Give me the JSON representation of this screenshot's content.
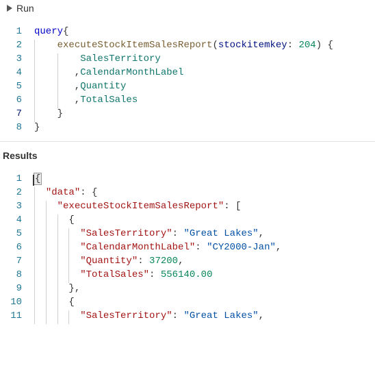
{
  "toolbar": {
    "run_label": "Run"
  },
  "results_header": "Results",
  "query_lines": [
    {
      "n": 1,
      "segs": [
        {
          "t": "query",
          "c": "kw"
        },
        {
          "t": "{",
          "c": "punc"
        }
      ]
    },
    {
      "n": 2,
      "indent": 1,
      "segs": [
        {
          "t": "    ",
          "c": ""
        },
        {
          "t": "executeStockItemSalesReport",
          "c": "call"
        },
        {
          "t": "(",
          "c": "punc"
        },
        {
          "t": "stockitemkey",
          "c": "arg"
        },
        {
          "t": ": ",
          "c": "punc"
        },
        {
          "t": "204",
          "c": "num"
        },
        {
          "t": ") {",
          "c": "punc"
        }
      ]
    },
    {
      "n": 3,
      "indent": 2,
      "segs": [
        {
          "t": "        ",
          "c": ""
        },
        {
          "t": "SalesTerritory",
          "c": "field"
        }
      ]
    },
    {
      "n": 4,
      "indent": 2,
      "segs": [
        {
          "t": "       ,",
          "c": "punc"
        },
        {
          "t": "CalendarMonthLabel",
          "c": "field"
        }
      ]
    },
    {
      "n": 5,
      "indent": 2,
      "segs": [
        {
          "t": "       ,",
          "c": "punc"
        },
        {
          "t": "Quantity",
          "c": "field"
        }
      ]
    },
    {
      "n": 6,
      "indent": 2,
      "segs": [
        {
          "t": "       ,",
          "c": "punc"
        },
        {
          "t": "TotalSales",
          "c": "field"
        }
      ]
    },
    {
      "n": 7,
      "indent": 1,
      "segs": [
        {
          "t": "    ",
          "c": ""
        },
        {
          "t": "}",
          "c": "punc"
        }
      ],
      "active": true
    },
    {
      "n": 8,
      "segs": [
        {
          "t": "}",
          "c": "punc"
        }
      ]
    }
  ],
  "result_lines": [
    {
      "n": 1,
      "segs": [
        {
          "t": "{",
          "c": "punc cursor-brace"
        }
      ],
      "cursor": true
    },
    {
      "n": 2,
      "indent": 1,
      "segs": [
        {
          "t": "  ",
          "c": ""
        },
        {
          "t": "\"data\"",
          "c": "prop"
        },
        {
          "t": ": {",
          "c": "punc"
        }
      ]
    },
    {
      "n": 3,
      "indent": 2,
      "segs": [
        {
          "t": "    ",
          "c": ""
        },
        {
          "t": "\"executeStockItemSalesReport\"",
          "c": "prop"
        },
        {
          "t": ": [",
          "c": "punc"
        }
      ]
    },
    {
      "n": 4,
      "indent": 3,
      "segs": [
        {
          "t": "      ",
          "c": ""
        },
        {
          "t": "{",
          "c": "punc"
        }
      ]
    },
    {
      "n": 5,
      "indent": 4,
      "segs": [
        {
          "t": "        ",
          "c": ""
        },
        {
          "t": "\"SalesTerritory\"",
          "c": "prop"
        },
        {
          "t": ": ",
          "c": "punc"
        },
        {
          "t": "\"Great Lakes\"",
          "c": "str"
        },
        {
          "t": ",",
          "c": "punc"
        }
      ]
    },
    {
      "n": 6,
      "indent": 4,
      "segs": [
        {
          "t": "        ",
          "c": ""
        },
        {
          "t": "\"CalendarMonthLabel\"",
          "c": "prop"
        },
        {
          "t": ": ",
          "c": "punc"
        },
        {
          "t": "\"CY2000-Jan\"",
          "c": "str"
        },
        {
          "t": ",",
          "c": "punc"
        }
      ]
    },
    {
      "n": 7,
      "indent": 4,
      "segs": [
        {
          "t": "        ",
          "c": ""
        },
        {
          "t": "\"Quantity\"",
          "c": "prop"
        },
        {
          "t": ": ",
          "c": "punc"
        },
        {
          "t": "37200",
          "c": "num"
        },
        {
          "t": ",",
          "c": "punc"
        }
      ]
    },
    {
      "n": 8,
      "indent": 4,
      "segs": [
        {
          "t": "        ",
          "c": ""
        },
        {
          "t": "\"TotalSales\"",
          "c": "prop"
        },
        {
          "t": ": ",
          "c": "punc"
        },
        {
          "t": "556140.00",
          "c": "num"
        }
      ]
    },
    {
      "n": 9,
      "indent": 3,
      "segs": [
        {
          "t": "      ",
          "c": ""
        },
        {
          "t": "}",
          "c": "punc"
        },
        {
          "t": ",",
          "c": "punc"
        }
      ]
    },
    {
      "n": 10,
      "indent": 3,
      "segs": [
        {
          "t": "      ",
          "c": ""
        },
        {
          "t": "{",
          "c": "punc"
        }
      ]
    },
    {
      "n": 11,
      "indent": 4,
      "segs": [
        {
          "t": "        ",
          "c": ""
        },
        {
          "t": "\"SalesTerritory\"",
          "c": "prop"
        },
        {
          "t": ": ",
          "c": "punc"
        },
        {
          "t": "\"Great Lakes\"",
          "c": "str"
        },
        {
          "t": ",",
          "c": "punc"
        }
      ]
    }
  ]
}
